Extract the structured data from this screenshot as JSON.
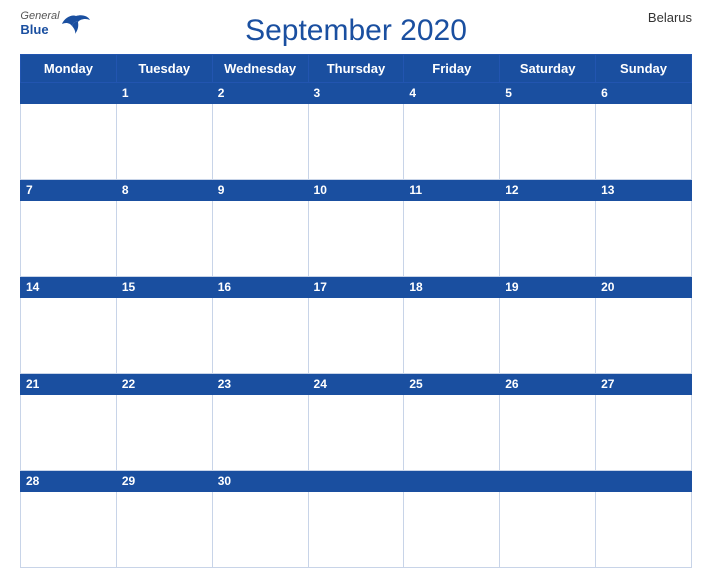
{
  "header": {
    "title": "September 2020",
    "country": "Belarus",
    "logo": {
      "general": "General",
      "blue": "Blue"
    }
  },
  "days_of_week": [
    "Monday",
    "Tuesday",
    "Wednesday",
    "Thursday",
    "Friday",
    "Saturday",
    "Sunday"
  ],
  "weeks": [
    {
      "band": [
        null,
        1,
        2,
        3,
        4,
        5,
        6
      ]
    },
    {
      "band": [
        7,
        8,
        9,
        10,
        11,
        12,
        13
      ]
    },
    {
      "band": [
        14,
        15,
        16,
        17,
        18,
        19,
        20
      ]
    },
    {
      "band": [
        21,
        22,
        23,
        24,
        25,
        26,
        27
      ]
    },
    {
      "band": [
        28,
        29,
        30,
        null,
        null,
        null,
        null
      ]
    }
  ]
}
